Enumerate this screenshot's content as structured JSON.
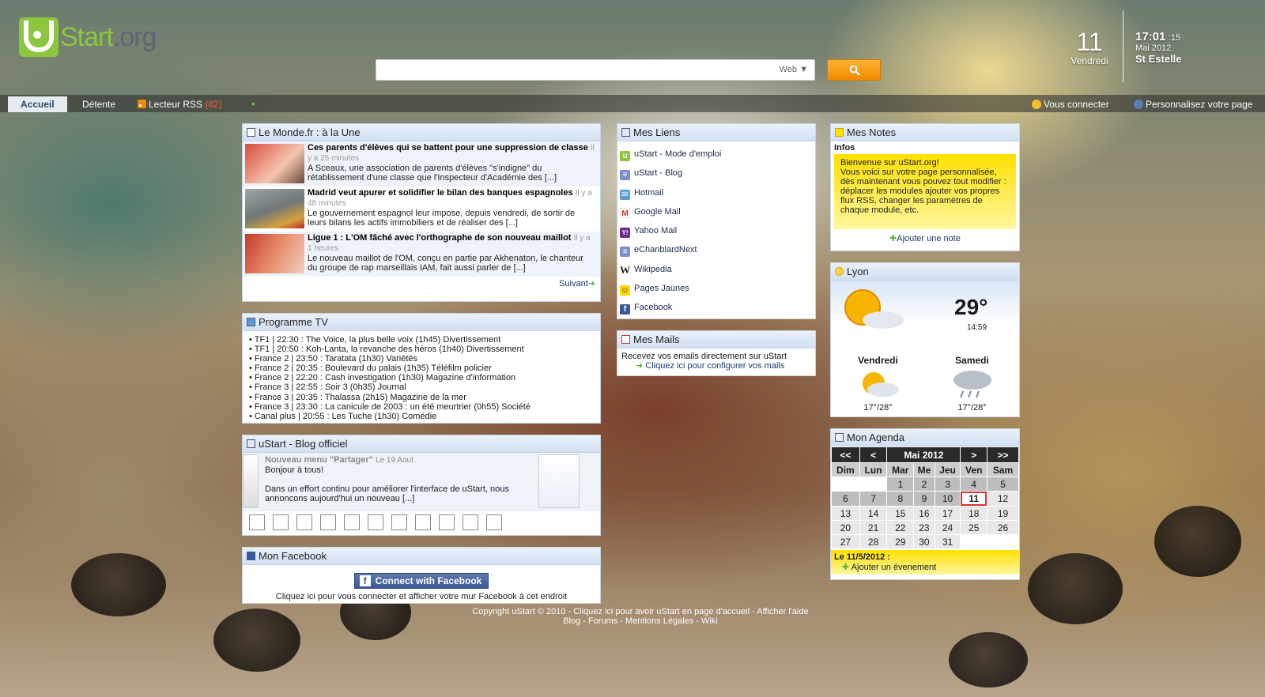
{
  "header": {
    "logo_u": "u",
    "logo_start": "Start",
    "logo_org": ".org",
    "search_placeholder": "",
    "search_engine": "Web ▼",
    "date_day_num": "11",
    "date_day_name": "Vendredi",
    "clock_time": "17:01",
    "clock_seconds": ":15",
    "month_year": "Mai 2012",
    "saint": "St Estelle"
  },
  "tabs": [
    {
      "label": "Accueil",
      "active": true
    },
    {
      "label": "Détente"
    },
    {
      "label": "Lecteur RSS",
      "count": "(82)"
    }
  ],
  "top_links": {
    "connect": "Vous connecter",
    "customize": "Personnalisez votre page"
  },
  "lemonde": {
    "title": "Le Monde.fr : à la Une",
    "items": [
      {
        "title": "Ces parents d'élèves qui se battent pour une suppression de classe",
        "time": "Il y a 25 minutes",
        "desc": "A Sceaux, une association de parents d'élèves \"s'indigne\" du rétablissement d'une classe que l'Inspecteur d'Académie des [...]"
      },
      {
        "title": "Madrid veut apurer et solidifier le bilan des banques espagnoles",
        "time": "Il y a 48 minutes",
        "desc": "Le gouvernement espagnol leur impose, depuis vendredi, de sortir de leurs bilans les actifs immobiliers et de réaliser des [...]"
      },
      {
        "title": "Ligue 1 : L'OM fâché avec l'orthographe de son nouveau maillot",
        "time": "Il y a 1 heures",
        "desc": "Le nouveau maillot de l'OM, conçu en partie par Akhenaton, le chanteur du groupe de rap marseillais IAM, fait aussi parler de [...]"
      }
    ],
    "next": "Suivant"
  },
  "tv": {
    "title": "Programme TV",
    "items": [
      "TF1 | 22:30 : The Voice, la plus belle voix (1h45) Divertissement",
      "TF1 | 20:50 : Koh-Lanta, la revanche des héros (1h40) Divertissement",
      "France 2 | 23:50 : Taratata (1h30) Variétés",
      "France 2 | 20:35 : Boulevard du palais (1h35) Téléfilm policier",
      "France 2 | 22:20 : Cash investigation (1h30) Magazine d'information",
      "France 3 | 22:55 : Soir 3 (0h35) Journal",
      "France 3 | 20:35 : Thalassa (2h15) Magazine de la mer",
      "France 3 | 23:30 : La canicule de 2003 : un été meurtrier (0h55) Société",
      "Canal plus | 20:55 : Les Tuche (1h30) Comédie"
    ]
  },
  "blog": {
    "title": "uStart - Blog officiel",
    "post_title": "Nouveau menu \"Partager\"",
    "post_date": "Le 19 Aout",
    "line1": "Bonjour à tous!",
    "line2": "Dans un effort continu pour améliorer l'interface de uStart, nous annoncons aujourd'hui un nouveau [...]"
  },
  "facebook": {
    "title": "Mon Facebook",
    "button": "Connect with Facebook",
    "text": "Cliquez ici pour vous connecter et afficher votre mur Facebook à cet endroit"
  },
  "links": {
    "title": "Mes Liens",
    "items": [
      {
        "label": "uStart - Mode d'emploi",
        "icon": "ustart-icon",
        "color": "#8cc63f",
        "glyph": "u"
      },
      {
        "label": "uStart - Blog",
        "icon": "blog-icon",
        "color": "#7a8fc8",
        "glyph": "≡"
      },
      {
        "label": "Hotmail",
        "icon": "hotmail-icon",
        "color": "#5a9ed6",
        "glyph": "✉"
      },
      {
        "label": "Google Mail",
        "icon": "gmail-icon",
        "color": "#d93025",
        "glyph": "M"
      },
      {
        "label": "Yahoo Mail",
        "icon": "yahoo-icon",
        "color": "#6b2c91",
        "glyph": "Y!"
      },
      {
        "label": "eChanblardNext",
        "icon": "echanblard-icon",
        "color": "#7a8fc8",
        "glyph": "≡"
      },
      {
        "label": "Wikipedia",
        "icon": "wikipedia-icon",
        "color": "#444444",
        "glyph": "W"
      },
      {
        "label": "Pages Jaunes",
        "icon": "pagesjaunes-icon",
        "color": "#e6b800",
        "glyph": "☺"
      },
      {
        "label": "Facebook",
        "icon": "facebook-icon",
        "color": "#3b5998",
        "glyph": "f"
      }
    ]
  },
  "mails": {
    "title": "Mes Mails",
    "text": "Recevez vos emails directement sur uStart",
    "link": "Cliquez ici pour configurer vos mails"
  },
  "notes": {
    "title": "Mes Notes",
    "tab": "Infos",
    "content": "Bienvenue sur uStart.org!\nVous voici sur votre page personnalisée, dès maintenant vous pouvez tout modifier :\ndéplacer les modules ajouter vos propres flux RSS, changer les paramètres de chaque module, etc.",
    "add": "Ajouter une note"
  },
  "weather": {
    "city": "Lyon",
    "temp": "29°",
    "time": "14:59",
    "forecast": [
      {
        "day": "Vendredi",
        "range": "17°/28°",
        "icon": "sun-cloud-icon"
      },
      {
        "day": "Samedi",
        "range": "17°/28°",
        "icon": "rain-cloud-icon"
      }
    ]
  },
  "agenda": {
    "title": "Mon Agenda",
    "nav_prev_year": "<<",
    "nav_prev": "<",
    "month": "Mai 2012",
    "nav_next": ">",
    "nav_next_year": ">>",
    "dow": [
      "Dim",
      "Lun",
      "Mar",
      "Me",
      "Jeu",
      "Ven",
      "Sam"
    ],
    "weeks": [
      [
        "",
        "",
        "1",
        "2",
        "3",
        "4",
        "5"
      ],
      [
        "6",
        "7",
        "8",
        "9",
        "10",
        "11",
        "12"
      ],
      [
        "13",
        "14",
        "15",
        "16",
        "17",
        "18",
        "19"
      ],
      [
        "20",
        "21",
        "22",
        "23",
        "24",
        "25",
        "26"
      ],
      [
        "27",
        "28",
        "29",
        "30",
        "31",
        "",
        ""
      ]
    ],
    "today": "11",
    "selected_label": "Le 11/5/2012 :",
    "add": "Ajouter un évenement"
  },
  "footer": {
    "line1": [
      "Copyright uStart © 2010",
      "Cliquez ici pour avoir uStart en page d'accueil",
      "Afficher l'aide"
    ],
    "line2": [
      "Blog",
      "Forums",
      "Mentions Légales",
      "Wiki"
    ]
  }
}
